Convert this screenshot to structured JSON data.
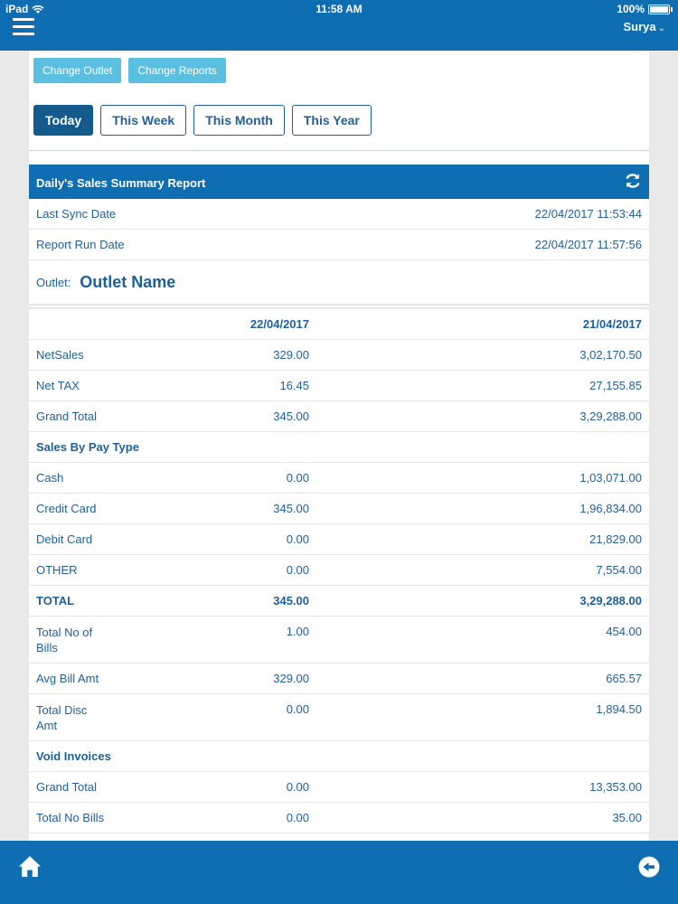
{
  "status": {
    "device": "iPad",
    "time": "11:58 AM",
    "battery": "100%"
  },
  "header": {
    "user": "Surya"
  },
  "buttons": {
    "change_outlet": "Change Outlet",
    "change_reports": "Change Reports"
  },
  "tabs": [
    "Today",
    "This Week",
    "This Month",
    "This Year"
  ],
  "report": {
    "title": "Daily's Sales Summary Report",
    "last_sync_label": "Last Sync Date",
    "last_sync_value": "22/04/2017 11:53:44",
    "run_label": "Report Run Date",
    "run_value": "22/04/2017 11:57:56",
    "outlet_label": "Outlet:",
    "outlet_name": "Outlet Name",
    "col1": "22/04/2017",
    "col2": "21/04/2017",
    "rows": [
      {
        "label": "NetSales",
        "v1": "329.00",
        "v2": "3,02,170.50"
      },
      {
        "label": "Net TAX",
        "v1": "16.45",
        "v2": "27,155.85"
      },
      {
        "label": "Grand Total",
        "v1": "345.00",
        "v2": "3,29,288.00"
      },
      {
        "label": "Sales By Pay Type"
      },
      {
        "label": "Cash",
        "v1": "0.00",
        "v2": "1,03,071.00"
      },
      {
        "label": "Credit Card",
        "v1": "345.00",
        "v2": "1,96,834.00"
      },
      {
        "label": "Debit Card",
        "v1": "0.00",
        "v2": "21,829.00"
      },
      {
        "label": "OTHER",
        "v1": "0.00",
        "v2": "7,554.00"
      },
      {
        "label": "TOTAL",
        "v1": "345.00",
        "v2": "3,29,288.00"
      },
      {
        "label": "Total No of Bills",
        "v1": "1.00",
        "v2": "454.00"
      },
      {
        "label": "Avg Bill Amt",
        "v1": "329.00",
        "v2": "665.57"
      },
      {
        "label": "Total Disc Amt",
        "v1": "0.00",
        "v2": "1,894.50"
      },
      {
        "label": "Void Invoices"
      },
      {
        "label": "Grand Total",
        "v1": "0.00",
        "v2": "13,353.00"
      },
      {
        "label": "Total No Bills",
        "v1": "0.00",
        "v2": "35.00"
      }
    ]
  }
}
